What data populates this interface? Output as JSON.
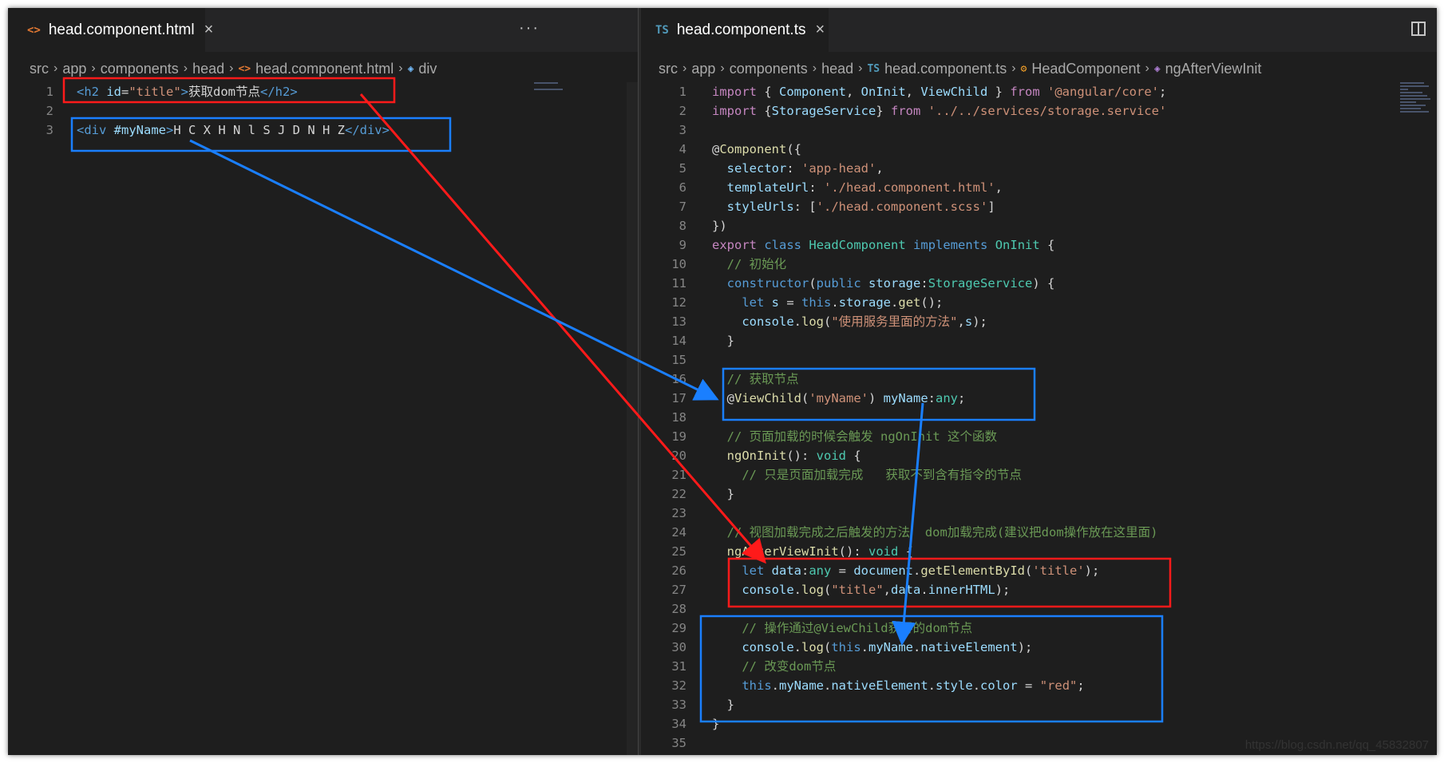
{
  "left_editor": {
    "tab": {
      "icon": "<>",
      "label": "head.component.html",
      "close": "×"
    },
    "more": "···",
    "breadcrumb": [
      "src",
      "app",
      "components",
      "head",
      "head.component.html",
      "div"
    ],
    "lines": [
      {
        "n": "1",
        "tokens": [
          [
            "tag",
            "<h2 "
          ],
          [
            "at",
            "id"
          ],
          [
            "p",
            "="
          ],
          [
            "s",
            "\"title\""
          ],
          [
            "tag",
            ">"
          ],
          [
            "p",
            "获取dom节点"
          ],
          [
            "tag",
            "</h2>"
          ]
        ]
      },
      {
        "n": "2",
        "tokens": []
      },
      {
        "n": "3",
        "tokens": [
          [
            "tag",
            "<div "
          ],
          [
            "at",
            "#myName"
          ],
          [
            "tag",
            ">"
          ],
          [
            "p",
            "H C X H N l S J D N H Z"
          ],
          [
            "tag",
            "</div>"
          ]
        ]
      }
    ]
  },
  "right_editor": {
    "tab": {
      "icon": "TS",
      "label": "head.component.ts",
      "close": "×"
    },
    "breadcrumb": [
      "src",
      "app",
      "components",
      "head",
      "head.component.ts",
      "HeadComponent",
      "ngAfterViewInit"
    ],
    "lines": [
      {
        "n": "1",
        "tokens": [
          [
            "k",
            "import"
          ],
          [
            "p",
            " { "
          ],
          [
            "v",
            "Component"
          ],
          [
            "p",
            ", "
          ],
          [
            "v",
            "OnInit"
          ],
          [
            "p",
            ", "
          ],
          [
            "v",
            "ViewChild"
          ],
          [
            "p",
            " } "
          ],
          [
            "k",
            "from"
          ],
          [
            "p",
            " "
          ],
          [
            "s",
            "'@angular/core'"
          ],
          [
            "p",
            ";"
          ]
        ]
      },
      {
        "n": "2",
        "tokens": [
          [
            "k",
            "import"
          ],
          [
            "p",
            " {"
          ],
          [
            "v",
            "StorageService"
          ],
          [
            "p",
            "} "
          ],
          [
            "k",
            "from"
          ],
          [
            "p",
            " "
          ],
          [
            "s",
            "'../../services/storage.service'"
          ]
        ]
      },
      {
        "n": "3",
        "tokens": []
      },
      {
        "n": "4",
        "tokens": [
          [
            "p",
            "@"
          ],
          [
            "f",
            "Component"
          ],
          [
            "p",
            "({"
          ]
        ]
      },
      {
        "n": "5",
        "tokens": [
          [
            "p",
            "  "
          ],
          [
            "v",
            "selector"
          ],
          [
            "p",
            ": "
          ],
          [
            "s",
            "'app-head'"
          ],
          [
            "p",
            ","
          ]
        ]
      },
      {
        "n": "6",
        "tokens": [
          [
            "p",
            "  "
          ],
          [
            "v",
            "templateUrl"
          ],
          [
            "p",
            ": "
          ],
          [
            "s",
            "'./head.component.html'"
          ],
          [
            "p",
            ","
          ]
        ]
      },
      {
        "n": "7",
        "tokens": [
          [
            "p",
            "  "
          ],
          [
            "v",
            "styleUrls"
          ],
          [
            "p",
            ": ["
          ],
          [
            "s",
            "'./head.component.scss'"
          ],
          [
            "p",
            "]"
          ]
        ]
      },
      {
        "n": "8",
        "tokens": [
          [
            "p",
            "})"
          ]
        ]
      },
      {
        "n": "9",
        "tokens": [
          [
            "k",
            "export"
          ],
          [
            "p",
            " "
          ],
          [
            "kw",
            "class"
          ],
          [
            "p",
            " "
          ],
          [
            "t",
            "HeadComponent"
          ],
          [
            "p",
            " "
          ],
          [
            "kw",
            "implements"
          ],
          [
            "p",
            " "
          ],
          [
            "t",
            "OnInit"
          ],
          [
            "p",
            " {"
          ]
        ]
      },
      {
        "n": "10",
        "tokens": [
          [
            "p",
            "  "
          ],
          [
            "cm",
            "// 初始化"
          ]
        ]
      },
      {
        "n": "11",
        "tokens": [
          [
            "p",
            "  "
          ],
          [
            "kw",
            "constructor"
          ],
          [
            "p",
            "("
          ],
          [
            "kw",
            "public"
          ],
          [
            "p",
            " "
          ],
          [
            "v",
            "storage"
          ],
          [
            "p",
            ":"
          ],
          [
            "t",
            "StorageService"
          ],
          [
            "p",
            ") {"
          ]
        ]
      },
      {
        "n": "12",
        "tokens": [
          [
            "p",
            "    "
          ],
          [
            "kw",
            "let"
          ],
          [
            "p",
            " "
          ],
          [
            "v",
            "s"
          ],
          [
            "p",
            " = "
          ],
          [
            "kw",
            "this"
          ],
          [
            "p",
            "."
          ],
          [
            "v",
            "storage"
          ],
          [
            "p",
            "."
          ],
          [
            "f",
            "get"
          ],
          [
            "p",
            "();"
          ]
        ]
      },
      {
        "n": "13",
        "tokens": [
          [
            "p",
            "    "
          ],
          [
            "v",
            "console"
          ],
          [
            "p",
            "."
          ],
          [
            "f",
            "log"
          ],
          [
            "p",
            "("
          ],
          [
            "s",
            "\"使用服务里面的方法\""
          ],
          [
            "p",
            ","
          ],
          [
            "v",
            "s"
          ],
          [
            "p",
            ");"
          ]
        ]
      },
      {
        "n": "14",
        "tokens": [
          [
            "p",
            "  }"
          ]
        ]
      },
      {
        "n": "15",
        "tokens": []
      },
      {
        "n": "16",
        "tokens": [
          [
            "p",
            "  "
          ],
          [
            "cm",
            "// 获取节点"
          ]
        ]
      },
      {
        "n": "17",
        "tokens": [
          [
            "p",
            "  @"
          ],
          [
            "f",
            "ViewChild"
          ],
          [
            "p",
            "("
          ],
          [
            "s",
            "'myName'"
          ],
          [
            "p",
            ") "
          ],
          [
            "v",
            "myName"
          ],
          [
            "p",
            ":"
          ],
          [
            "t",
            "any"
          ],
          [
            "p",
            ";"
          ]
        ]
      },
      {
        "n": "18",
        "tokens": []
      },
      {
        "n": "19",
        "tokens": [
          [
            "p",
            "  "
          ],
          [
            "cm",
            "// 页面加载的时候会触发 ngOnInit 这个函数"
          ]
        ]
      },
      {
        "n": "20",
        "tokens": [
          [
            "p",
            "  "
          ],
          [
            "f",
            "ngOnInit"
          ],
          [
            "p",
            "(): "
          ],
          [
            "t",
            "void"
          ],
          [
            "p",
            " {"
          ]
        ]
      },
      {
        "n": "21",
        "tokens": [
          [
            "p",
            "    "
          ],
          [
            "cm",
            "// 只是页面加载完成   获取不到含有指令的节点"
          ]
        ]
      },
      {
        "n": "22",
        "tokens": [
          [
            "p",
            "  }"
          ]
        ]
      },
      {
        "n": "23",
        "tokens": []
      },
      {
        "n": "24",
        "tokens": [
          [
            "p",
            "  "
          ],
          [
            "cm",
            "// 视图加载完成之后触发的方法  dom加载完成(建议把dom操作放在这里面)"
          ]
        ]
      },
      {
        "n": "25",
        "tokens": [
          [
            "p",
            "  "
          ],
          [
            "f",
            "ngAfterViewInit"
          ],
          [
            "p",
            "(): "
          ],
          [
            "t",
            "void"
          ],
          [
            "p",
            " {"
          ]
        ]
      },
      {
        "n": "26",
        "tokens": [
          [
            "p",
            "    "
          ],
          [
            "kw",
            "let"
          ],
          [
            "p",
            " "
          ],
          [
            "v",
            "data"
          ],
          [
            "p",
            ":"
          ],
          [
            "t",
            "any"
          ],
          [
            "p",
            " = "
          ],
          [
            "v",
            "document"
          ],
          [
            "p",
            "."
          ],
          [
            "f",
            "getElementById"
          ],
          [
            "p",
            "("
          ],
          [
            "s",
            "'title'"
          ],
          [
            "p",
            ");"
          ]
        ]
      },
      {
        "n": "27",
        "tokens": [
          [
            "p",
            "    "
          ],
          [
            "v",
            "console"
          ],
          [
            "p",
            "."
          ],
          [
            "f",
            "log"
          ],
          [
            "p",
            "("
          ],
          [
            "s",
            "\"title\""
          ],
          [
            "p",
            ","
          ],
          [
            "v",
            "data"
          ],
          [
            "p",
            "."
          ],
          [
            "v",
            "innerHTML"
          ],
          [
            "p",
            ");"
          ]
        ]
      },
      {
        "n": "28",
        "tokens": []
      },
      {
        "n": "29",
        "tokens": [
          [
            "p",
            "    "
          ],
          [
            "cm",
            "// 操作通过@ViewChild获得的dom节点"
          ]
        ]
      },
      {
        "n": "30",
        "tokens": [
          [
            "p",
            "    "
          ],
          [
            "v",
            "console"
          ],
          [
            "p",
            "."
          ],
          [
            "f",
            "log"
          ],
          [
            "p",
            "("
          ],
          [
            "kw",
            "this"
          ],
          [
            "p",
            "."
          ],
          [
            "v",
            "myName"
          ],
          [
            "p",
            "."
          ],
          [
            "v",
            "nativeElement"
          ],
          [
            "p",
            ");"
          ]
        ]
      },
      {
        "n": "31",
        "tokens": [
          [
            "p",
            "    "
          ],
          [
            "cm",
            "// 改变dom节点"
          ]
        ]
      },
      {
        "n": "32",
        "tokens": [
          [
            "p",
            "    "
          ],
          [
            "kw",
            "this"
          ],
          [
            "p",
            "."
          ],
          [
            "v",
            "myName"
          ],
          [
            "p",
            "."
          ],
          [
            "v",
            "nativeElement"
          ],
          [
            "p",
            "."
          ],
          [
            "v",
            "style"
          ],
          [
            "p",
            "."
          ],
          [
            "v",
            "color"
          ],
          [
            "p",
            " = "
          ],
          [
            "s",
            "\"red\""
          ],
          [
            "p",
            ";"
          ]
        ]
      },
      {
        "n": "33",
        "tokens": [
          [
            "p",
            "  }"
          ]
        ]
      },
      {
        "n": "34",
        "tokens": [
          [
            "p",
            "}"
          ]
        ]
      },
      {
        "n": "35",
        "tokens": []
      }
    ]
  },
  "annotation_colors": {
    "red": "#ff1a1a",
    "blue": "#1a7fff"
  },
  "watermark": "https://blog.csdn.net/qq_45832807"
}
